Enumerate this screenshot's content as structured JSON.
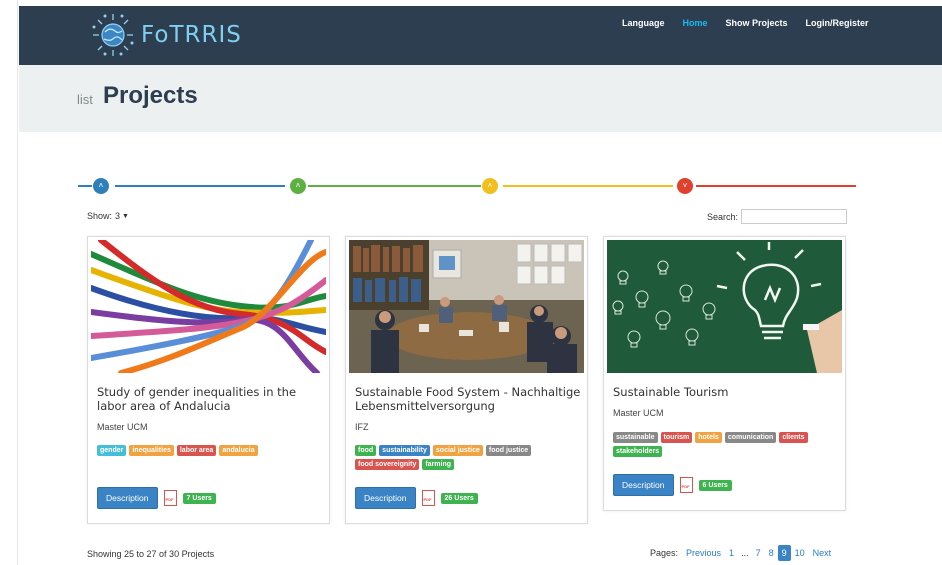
{
  "header": {
    "logo_text": "FoTRRIS",
    "nav": [
      {
        "label": "Language",
        "active": false
      },
      {
        "label": "Home",
        "active": true
      },
      {
        "label": "Show Projects",
        "active": false
      },
      {
        "label": "Login/Register",
        "active": false
      }
    ]
  },
  "page": {
    "title_prefix": "list",
    "title": "Projects"
  },
  "wizard": {
    "colors": [
      "#2f7fb8",
      "#5fb043",
      "#f3bf1e",
      "#e0412f"
    ]
  },
  "controls": {
    "show_label": "Show:",
    "show_value": "3",
    "search_label": "Search:",
    "search_value": ""
  },
  "cards": [
    {
      "title": "Study of gender inequalities in the labor area of Andalucia",
      "org": "Master UCM",
      "tags": [
        {
          "label": "gender",
          "color": "#45bfd9"
        },
        {
          "label": "inequalities",
          "color": "#f0a340"
        },
        {
          "label": "labor area",
          "color": "#d9534f"
        },
        {
          "label": "andalucia",
          "color": "#f0a340"
        }
      ],
      "button": "Description",
      "users": "7 Users"
    },
    {
      "title": "Sustainable Food System - Nachhaltige Lebensmittelversorgung",
      "org": "IFZ",
      "tags": [
        {
          "label": "food",
          "color": "#3fb34f"
        },
        {
          "label": "sustainability",
          "color": "#3a83c5"
        },
        {
          "label": "social justice",
          "color": "#f0a340"
        },
        {
          "label": "food justice",
          "color": "#888888"
        },
        {
          "label": "food sovereignity",
          "color": "#d9534f"
        },
        {
          "label": "farming",
          "color": "#3fb34f"
        }
      ],
      "button": "Description",
      "users": "26 Users"
    },
    {
      "title": "Sustainable Tourism",
      "org": "Master UCM",
      "tags": [
        {
          "label": "sustainable",
          "color": "#888888"
        },
        {
          "label": "tourism",
          "color": "#d9534f"
        },
        {
          "label": "hotels",
          "color": "#f0a340"
        },
        {
          "label": "comunication",
          "color": "#888888"
        },
        {
          "label": "clients",
          "color": "#d9534f"
        },
        {
          "label": "stakeholders",
          "color": "#3fb34f"
        }
      ],
      "button": "Description",
      "users": "6 Users"
    }
  ],
  "footer": {
    "showing": "Showing 25 to 27 of 30 Projects",
    "pages_label": "Pages:",
    "previous": "Previous",
    "pages": [
      "1",
      "...",
      "7",
      "8",
      "9",
      "10"
    ],
    "current": "9",
    "next": "Next"
  }
}
